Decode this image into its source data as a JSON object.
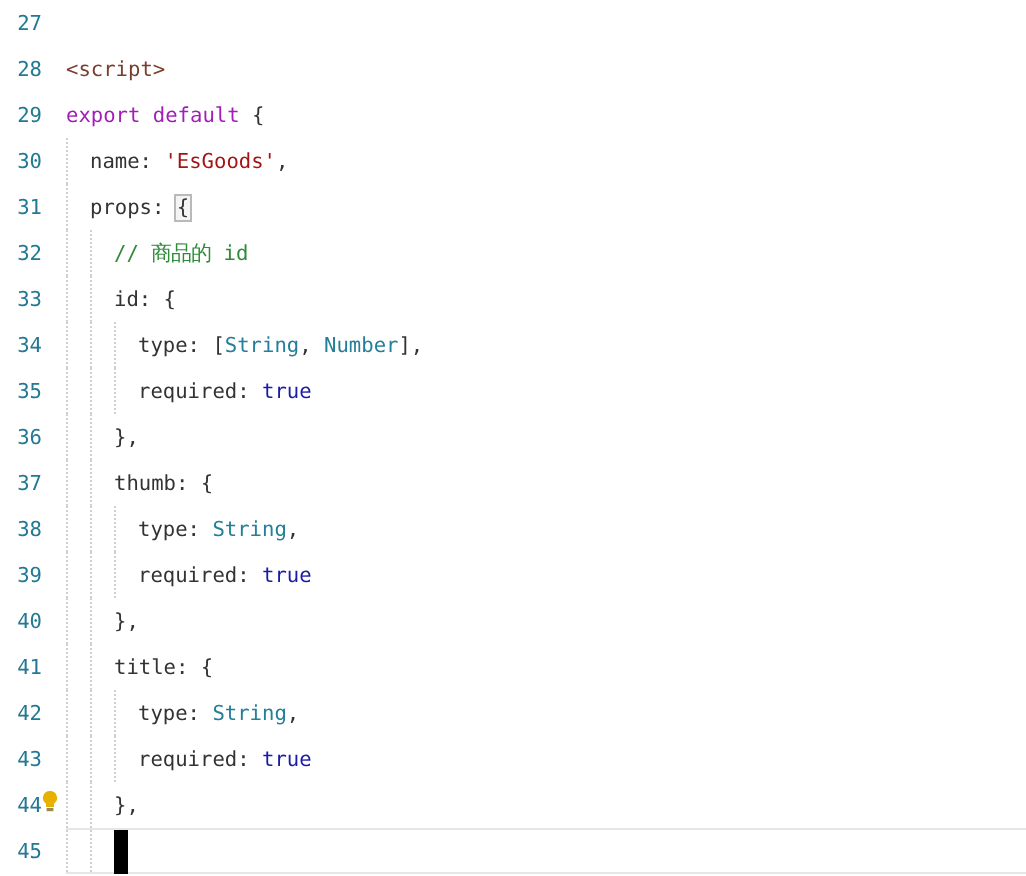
{
  "editor": {
    "lines": [
      {
        "number": "27",
        "current": false,
        "lightbulb": false
      },
      {
        "number": "28",
        "current": false,
        "lightbulb": false,
        "tokens": [
          {
            "kind": "tag",
            "text": "<script>"
          }
        ]
      },
      {
        "number": "29",
        "current": false,
        "lightbulb": false,
        "tokens": [
          {
            "kind": "keyword",
            "text": "export default"
          },
          {
            "kind": "plain",
            "text": " {"
          }
        ],
        "children": [
          {
            "number": "30",
            "current": false,
            "lightbulb": false,
            "tokens": [
              {
                "kind": "plain",
                "text": "name: "
              },
              {
                "kind": "string",
                "text": "'EsGoods'"
              },
              {
                "kind": "plain",
                "text": ","
              }
            ]
          },
          {
            "number": "31",
            "current": false,
            "lightbulb": false,
            "tokens": [
              {
                "kind": "plain",
                "text": "props: "
              },
              {
                "kind": "bracket-match",
                "text": "{"
              }
            ],
            "children": [
              {
                "number": "32",
                "current": false,
                "lightbulb": false,
                "tokens": [
                  {
                    "kind": "comment",
                    "text": "// 商品的 id"
                  }
                ]
              },
              {
                "number": "33",
                "current": false,
                "lightbulb": false,
                "tokens": [
                  {
                    "kind": "plain",
                    "text": "id: {"
                  }
                ],
                "children": [
                  {
                    "number": "34",
                    "current": false,
                    "lightbulb": false,
                    "tokens": [
                      {
                        "kind": "plain",
                        "text": "type: ["
                      },
                      {
                        "kind": "type",
                        "text": "String"
                      },
                      {
                        "kind": "plain",
                        "text": ", "
                      },
                      {
                        "kind": "type",
                        "text": "Number"
                      },
                      {
                        "kind": "plain",
                        "text": "],"
                      }
                    ]
                  },
                  {
                    "number": "35",
                    "current": false,
                    "lightbulb": false,
                    "tokens": [
                      {
                        "kind": "plain",
                        "text": "required: "
                      },
                      {
                        "kind": "literal",
                        "text": "true"
                      }
                    ]
                  }
                ]
              },
              {
                "number": "36",
                "current": false,
                "lightbulb": false,
                "tokens": [
                  {
                    "kind": "plain",
                    "text": "},"
                  }
                ]
              },
              {
                "number": "37",
                "current": false,
                "lightbulb": false,
                "tokens": [
                  {
                    "kind": "plain",
                    "text": "thumb: {"
                  }
                ],
                "children": [
                  {
                    "number": "38",
                    "current": false,
                    "lightbulb": false,
                    "tokens": [
                      {
                        "kind": "plain",
                        "text": "type: "
                      },
                      {
                        "kind": "type",
                        "text": "String"
                      },
                      {
                        "kind": "plain",
                        "text": ","
                      }
                    ]
                  },
                  {
                    "number": "39",
                    "current": false,
                    "lightbulb": false,
                    "tokens": [
                      {
                        "kind": "plain",
                        "text": "required: "
                      },
                      {
                        "kind": "literal",
                        "text": "true"
                      }
                    ]
                  }
                ]
              },
              {
                "number": "40",
                "current": false,
                "lightbulb": false,
                "tokens": [
                  {
                    "kind": "plain",
                    "text": "},"
                  }
                ]
              },
              {
                "number": "41",
                "current": false,
                "lightbulb": false,
                "tokens": [
                  {
                    "kind": "plain",
                    "text": "title: {"
                  }
                ],
                "children": [
                  {
                    "number": "42",
                    "current": false,
                    "lightbulb": false,
                    "tokens": [
                      {
                        "kind": "plain",
                        "text": "type: "
                      },
                      {
                        "kind": "type",
                        "text": "String"
                      },
                      {
                        "kind": "plain",
                        "text": ","
                      }
                    ]
                  },
                  {
                    "number": "43",
                    "current": false,
                    "lightbulb": false,
                    "tokens": [
                      {
                        "kind": "plain",
                        "text": "required: "
                      },
                      {
                        "kind": "literal",
                        "text": "true"
                      }
                    ]
                  }
                ]
              },
              {
                "number": "44",
                "current": false,
                "lightbulb": true,
                "tokens": [
                  {
                    "kind": "plain",
                    "text": "},"
                  }
                ]
              },
              {
                "number": "45",
                "current": true,
                "lightbulb": false
              }
            ]
          }
        ]
      }
    ]
  }
}
